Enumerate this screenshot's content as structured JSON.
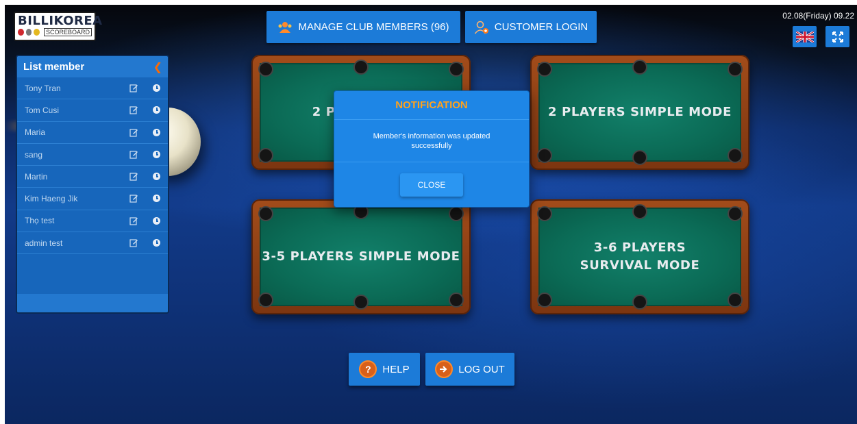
{
  "header": {
    "logo": {
      "brand": "BILLIKOREA",
      "sub": "SCOREBOARD"
    },
    "manage_members_label": "MANAGE CLUB MEMBERS (96)",
    "customer_login_label": "CUSTOMER LOGIN",
    "datetime": "02.08(Friday) 09.22"
  },
  "sidebar": {
    "title": "List member",
    "members": [
      "Tony Tran",
      "Tom Cusi",
      "Maria",
      "sang",
      "Martin",
      "Kim Haeng Jik",
      "Thọ test",
      "admin test"
    ]
  },
  "modes": [
    {
      "label": "2 PLAYERS ..."
    },
    {
      "label": "2 PLAYERS SIMPLE MODE"
    },
    {
      "label": "3-5 PLAYERS SIMPLE MODE"
    },
    {
      "label": "3-6 PLAYERS SURVIVAL MODE"
    }
  ],
  "footer": {
    "help_label": "HELP",
    "logout_label": "LOG OUT"
  },
  "modal": {
    "title": "NOTIFICATION",
    "message": "Member's information was updated successfully",
    "close_label": "CLOSE"
  },
  "colors": {
    "accent": "#1c7bd8",
    "title_orange": "#ffa21c",
    "felt_green": "#0b6b56"
  }
}
